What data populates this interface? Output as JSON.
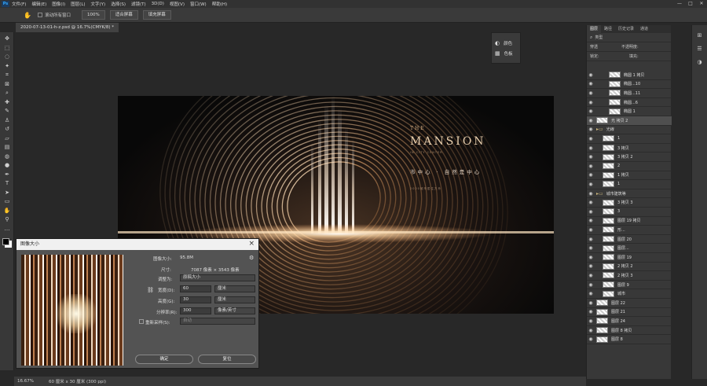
{
  "menubar": {
    "app_icon": "Ps",
    "items": [
      "文件(F)",
      "编辑(E)",
      "图像(I)",
      "图层(L)",
      "文字(Y)",
      "选择(S)",
      "滤镜(T)",
      "3D(D)",
      "视图(V)",
      "窗口(W)",
      "帮助(H)"
    ],
    "window_buttons": [
      "—",
      "□",
      "✕"
    ]
  },
  "options": {
    "scroll_all_label": "滚动所有窗口",
    "zoom_btn": "100%",
    "fit_btn": "适合屏幕",
    "fill_btn": "填充屏幕"
  },
  "document_tab": "2020-07-13-01-h-z.psd @ 16.7%(CMYK/8) *",
  "mini_panel": {
    "items": [
      "颜色",
      "色板"
    ]
  },
  "canvas_art": {
    "the": "THE",
    "headline": "MANSION",
    "subline": "IN CITY CENTER",
    "slogan": "市中心 · 自然是中心",
    "tag": "2020城市居住方舟"
  },
  "layers": {
    "tabs": [
      "图层",
      "路径",
      "历史记录",
      "通道"
    ],
    "filter_kind": "类型",
    "blend_mode": "穿透",
    "opacity_label": "不透明度:",
    "lock_label": "锁定:",
    "fill_label": "填充:",
    "rows": [
      {
        "name": "椭圆 1 拷贝",
        "indent": 2,
        "sel": false
      },
      {
        "name": "椭圆...10",
        "indent": 2,
        "sel": false
      },
      {
        "name": "椭圆...11",
        "indent": 2,
        "sel": false
      },
      {
        "name": "椭圆...6",
        "indent": 2,
        "sel": false
      },
      {
        "name": "椭圆 1",
        "indent": 2,
        "sel": false
      },
      {
        "name": "光 拷贝 2",
        "indent": 0,
        "sel": true
      },
      {
        "name": "光線",
        "indent": 0,
        "sel": false,
        "folder": true
      },
      {
        "name": "1",
        "indent": 1,
        "sel": false
      },
      {
        "name": "3 拷贝",
        "indent": 1,
        "sel": false
      },
      {
        "name": "3 拷贝 2",
        "indent": 1,
        "sel": false
      },
      {
        "name": "2",
        "indent": 1,
        "sel": false
      },
      {
        "name": "1 拷贝",
        "indent": 1,
        "sel": false
      },
      {
        "name": "1",
        "indent": 1,
        "sel": false
      },
      {
        "name": "城市建筑等",
        "indent": 0,
        "sel": false,
        "folder": true
      },
      {
        "name": "3 拷贝 3",
        "indent": 1,
        "sel": false
      },
      {
        "name": "3",
        "indent": 1,
        "sel": false
      },
      {
        "name": "图层 19 拷贝",
        "indent": 1,
        "sel": false
      },
      {
        "name": "形...",
        "indent": 1,
        "sel": false
      },
      {
        "name": "图层 20",
        "indent": 1,
        "sel": false
      },
      {
        "name": "图层...",
        "indent": 1,
        "sel": false
      },
      {
        "name": "图层 19",
        "indent": 1,
        "sel": false
      },
      {
        "name": "2 拷贝 2",
        "indent": 1,
        "sel": false
      },
      {
        "name": "2 拷贝 3",
        "indent": 1,
        "sel": false
      },
      {
        "name": "图层 9",
        "indent": 1,
        "sel": false
      },
      {
        "name": "城市",
        "indent": 1,
        "sel": false
      },
      {
        "name": "图层 22",
        "indent": 0,
        "sel": false
      },
      {
        "name": "图层 21",
        "indent": 0,
        "sel": false
      },
      {
        "name": "图层 24",
        "indent": 0,
        "sel": false
      },
      {
        "name": "图层 8 拷贝",
        "indent": 0,
        "sel": false
      },
      {
        "name": "图层 8",
        "indent": 0,
        "sel": false
      }
    ]
  },
  "status": {
    "zoom": "16.67%",
    "docinfo": "60 厘米 x 30 厘米 (300 ppi)"
  },
  "dialog": {
    "title": "图像大小",
    "size_label": "图像大小:",
    "size_value": "95.8M",
    "dims_label": "尺寸:",
    "dims_value": "7087 像素 × 3543 像素",
    "fit_label": "调整为:",
    "fit_value": "原稿大小",
    "width_label": "宽度(D):",
    "width_value": "60",
    "width_unit": "厘米",
    "height_label": "高度(G):",
    "height_value": "30",
    "height_unit": "厘米",
    "res_label": "分辨率(R):",
    "res_value": "300",
    "res_unit": "像素/英寸",
    "resample_label": "重新采样(S):",
    "resample_value": "自动",
    "ok": "确定",
    "reset": "复位"
  }
}
